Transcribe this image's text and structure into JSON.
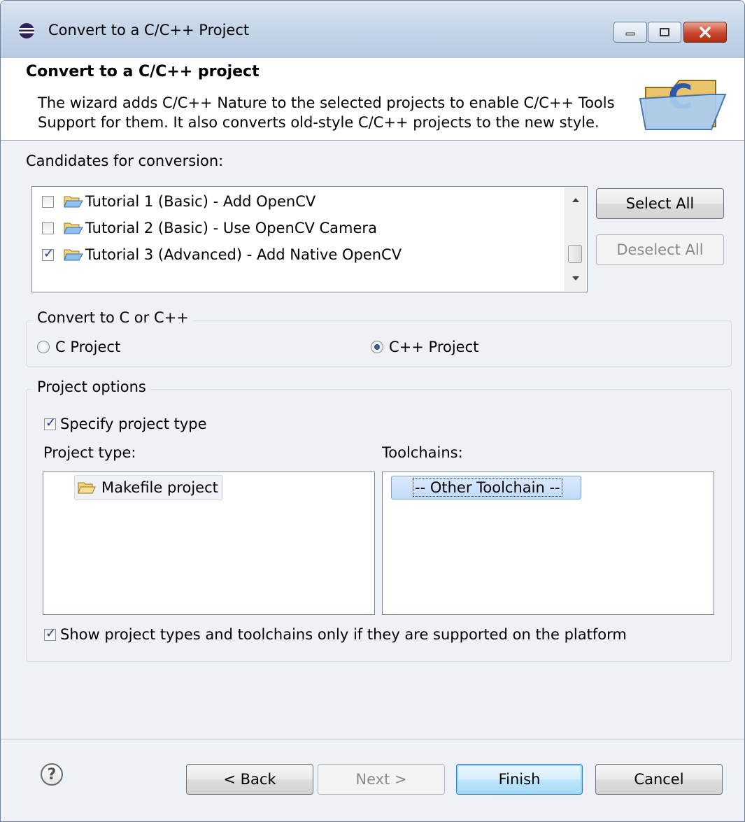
{
  "window": {
    "title": "Convert to a C/C++ Project"
  },
  "header": {
    "title": "Convert to a C/C++ project",
    "description_line1": "The wizard adds C/C++ Nature to the selected projects to enable C/C++ Tools",
    "description_line2": "Support for them. It also converts old-style C/C++ projects to the new style."
  },
  "candidates": {
    "label": "Candidates for conversion:",
    "items": [
      {
        "label": "Tutorial 1 (Basic) - Add OpenCV",
        "checked": false
      },
      {
        "label": "Tutorial 2 (Basic) - Use OpenCV Camera",
        "checked": false
      },
      {
        "label": "Tutorial 3 (Advanced) - Add Native OpenCV",
        "checked": true
      }
    ],
    "select_all": "Select All",
    "deselect_all": "Deselect All"
  },
  "convert": {
    "group_title": "Convert to C or C++",
    "c_project": "C Project",
    "cpp_project": "C++ Project",
    "selected": "cpp"
  },
  "options": {
    "group_title": "Project options",
    "specify_type": "Specify project type",
    "project_type_label": "Project type:",
    "project_types": [
      "Makefile project"
    ],
    "toolchains_label": "Toolchains:",
    "toolchains": [
      "-- Other Toolchain --"
    ],
    "show_supported": "Show project types and toolchains only if they are supported on the platform"
  },
  "footer": {
    "help": "?",
    "back": "< Back",
    "next": "Next >",
    "finish": "Finish",
    "cancel": "Cancel"
  },
  "colors": {
    "accent": "#3c7fb1",
    "close": "#c9462c"
  }
}
